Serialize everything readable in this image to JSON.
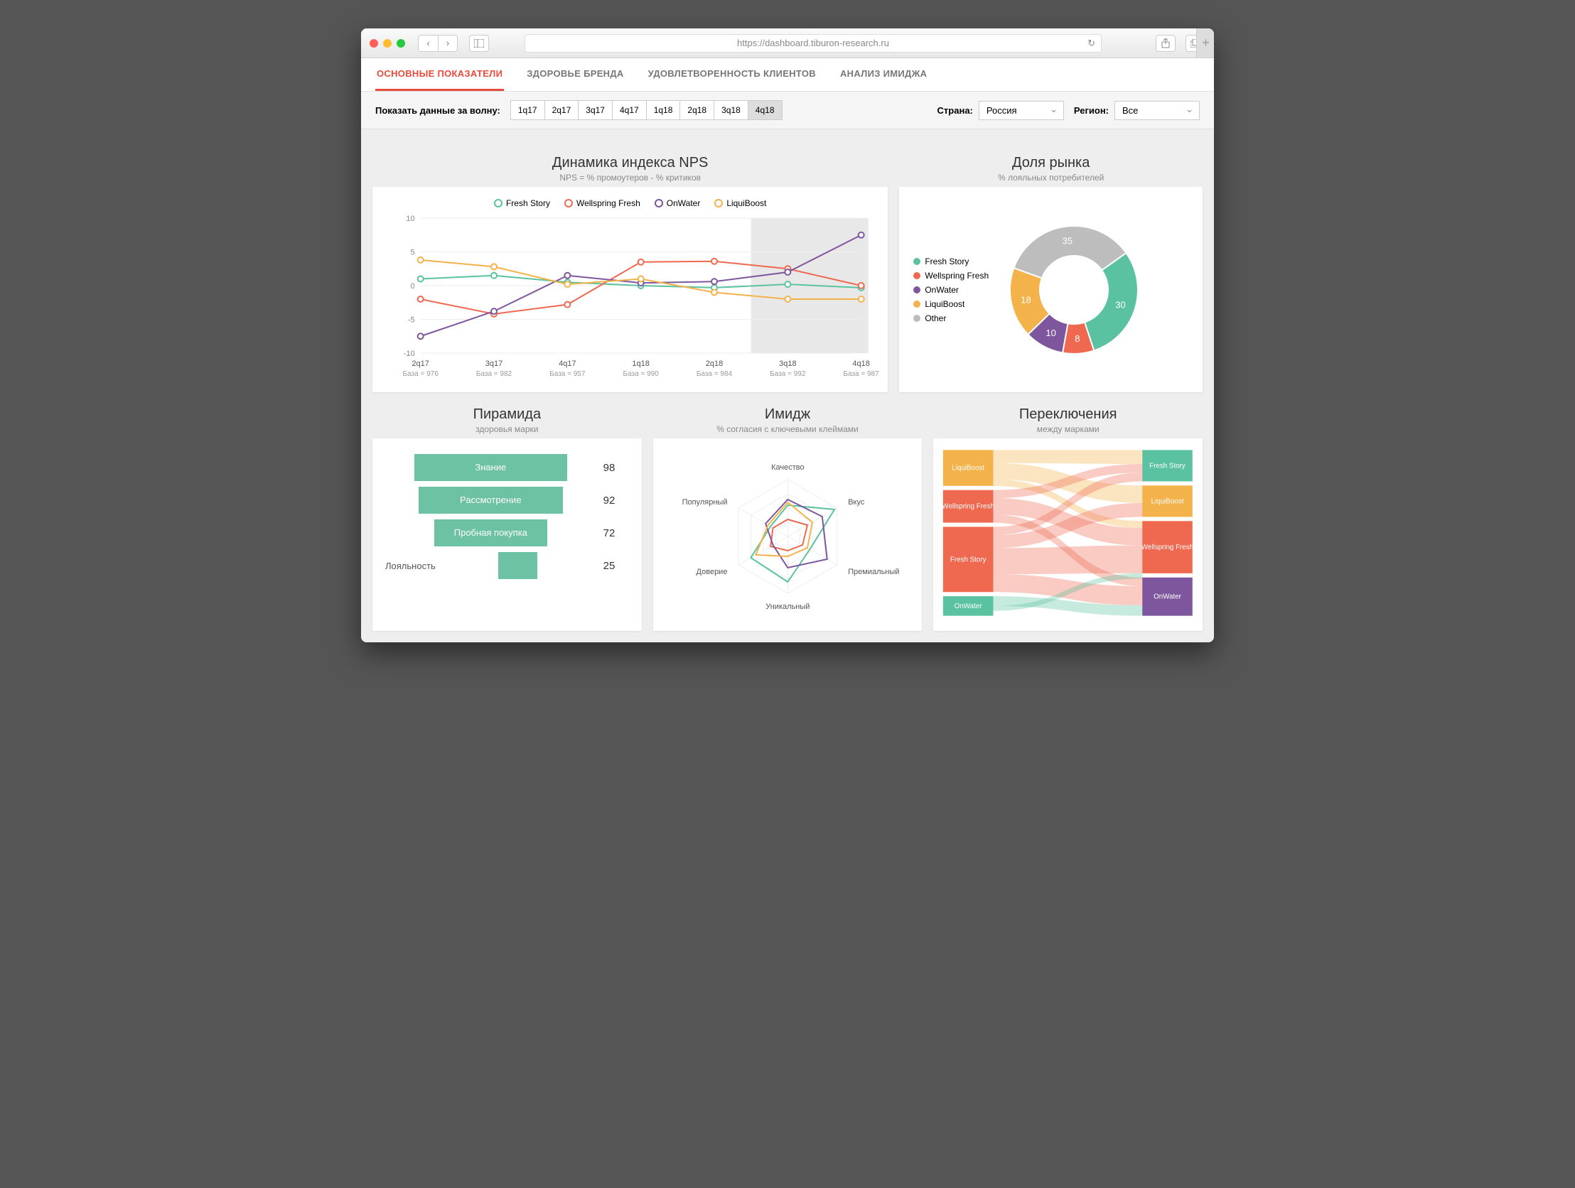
{
  "browser": {
    "url": "https://dashboard.tiburon-research.ru"
  },
  "tabs": [
    "ОСНОВНЫЕ ПОКАЗАТЕЛИ",
    "ЗДОРОВЬЕ БРЕНДА",
    "УДОВЛЕТВОРЕННОСТЬ КЛИЕНТОВ",
    "АНАЛИЗ ИМИДЖА"
  ],
  "active_tab": 0,
  "filters": {
    "wave_label": "Показать данные за волну:",
    "waves": [
      "1q17",
      "2q17",
      "3q17",
      "4q17",
      "1q18",
      "2q18",
      "3q18",
      "4q18"
    ],
    "selected_wave": "4q18",
    "country_label": "Страна:",
    "country_value": "Россия",
    "region_label": "Регион:",
    "region_value": "Все"
  },
  "colors": {
    "fresh_story": "#5bc2a1",
    "wellspring": "#ef6950",
    "onwater": "#7d569d",
    "liquiboost": "#f3b24a",
    "other": "#bdbdbd"
  },
  "nps": {
    "title": "Динамика индекса NPS",
    "subtitle": "NPS = % промоутеров - % критиков",
    "legend": [
      "Fresh Story",
      "Wellspring Fresh",
      "OnWater",
      "LiquiBoost"
    ]
  },
  "market": {
    "title": "Доля рынка",
    "subtitle": "% лояльных потребителей",
    "legend": [
      "Fresh Story",
      "Wellspring Fresh",
      "OnWater",
      "LiquiBoost",
      "Other"
    ]
  },
  "pyramid": {
    "title": "Пирамида",
    "subtitle": "здоровья марки",
    "rows": [
      {
        "label": "Знание",
        "value": 98
      },
      {
        "label": "Рассмотрение",
        "value": 92
      },
      {
        "label": "Пробная покупка",
        "value": 72
      },
      {
        "label": "Лояльность",
        "value": 25
      }
    ]
  },
  "image": {
    "title": "Имидж",
    "subtitle": "% согласия с ключевыми клеймами",
    "axes": [
      "Качество",
      "Вкус",
      "Премиальный",
      "Уникальный",
      "Доверие",
      "Популярный"
    ]
  },
  "switch": {
    "title": "Переключения",
    "subtitle": "между марками",
    "left": [
      "LiquiBoost",
      "Wellspring Fresh",
      "Fresh Story",
      "OnWater"
    ],
    "right": [
      "Fresh Story",
      "LiquiBoost",
      "Wellspring Fresh",
      "OnWater"
    ]
  },
  "chart_data": [
    {
      "id": "nps",
      "type": "line",
      "title": "Динамика индекса NPS",
      "xlabel": "",
      "ylabel": "",
      "ylim": [
        -10,
        10
      ],
      "categories": [
        "2q17",
        "3q17",
        "4q17",
        "1q18",
        "2q18",
        "3q18",
        "4q18"
      ],
      "base_labels": [
        "База = 976",
        "База = 982",
        "База = 957",
        "База = 990",
        "База = 984",
        "База = 992",
        "База = 987"
      ],
      "series": [
        {
          "name": "Fresh Story",
          "color": "#5bc2a1",
          "values": [
            1.0,
            1.5,
            0.5,
            0.0,
            -0.3,
            0.2,
            -0.3
          ]
        },
        {
          "name": "Wellspring Fresh",
          "color": "#ef6950",
          "values": [
            -2.0,
            -4.2,
            -2.8,
            3.5,
            3.6,
            2.5,
            0.0
          ]
        },
        {
          "name": "OnWater",
          "color": "#7d569d",
          "values": [
            -7.5,
            -3.8,
            1.5,
            0.4,
            0.6,
            2.0,
            7.5
          ]
        },
        {
          "name": "LiquiBoost",
          "color": "#f3b24a",
          "values": [
            3.8,
            2.8,
            0.2,
            1.0,
            -1.0,
            -2.0,
            -2.0
          ]
        }
      ],
      "highlight_x": [
        "3q18",
        "4q18"
      ]
    },
    {
      "id": "market_share",
      "type": "pie",
      "title": "Доля рынка",
      "slices": [
        {
          "name": "Fresh Story",
          "value": 30,
          "color": "#5bc2a1"
        },
        {
          "name": "Wellspring Fresh",
          "value": 8,
          "color": "#ef6950"
        },
        {
          "name": "OnWater",
          "value": 10,
          "color": "#7d569d"
        },
        {
          "name": "LiquiBoost",
          "value": 18,
          "color": "#f3b24a"
        },
        {
          "name": "Other",
          "value": 35,
          "color": "#bdbdbd"
        }
      ]
    },
    {
      "id": "pyramid",
      "type": "bar",
      "title": "Пирамида здоровья марки",
      "categories": [
        "Знание",
        "Рассмотрение",
        "Пробная покупка",
        "Лояльность"
      ],
      "values": [
        98,
        92,
        72,
        25
      ]
    },
    {
      "id": "image_radar",
      "type": "radar",
      "title": "Имидж",
      "axes": [
        "Качество",
        "Вкус",
        "Премиальный",
        "Уникальный",
        "Доверие",
        "Популярный"
      ],
      "range": [
        0,
        100
      ],
      "series": [
        {
          "name": "Fresh Story",
          "color": "#5bc2a1",
          "values": [
            55,
            95,
            45,
            80,
            75,
            35
          ]
        },
        {
          "name": "Wellspring Fresh",
          "color": "#ef6950",
          "values": [
            30,
            40,
            30,
            25,
            35,
            30
          ]
        },
        {
          "name": "OnWater",
          "color": "#7d569d",
          "values": [
            65,
            70,
            80,
            55,
            30,
            45
          ]
        },
        {
          "name": "LiquiBoost",
          "color": "#f3b24a",
          "values": [
            60,
            50,
            40,
            35,
            65,
            40
          ]
        }
      ]
    },
    {
      "id": "switching",
      "type": "sankey",
      "title": "Переключения между марками",
      "left_nodes": [
        {
          "name": "LiquiBoost",
          "value": 22,
          "color": "#f3b24a"
        },
        {
          "name": "Wellspring Fresh",
          "value": 20,
          "color": "#ef6950"
        },
        {
          "name": "Fresh Story",
          "value": 40,
          "color": "#ef6950"
        },
        {
          "name": "OnWater",
          "value": 12,
          "color": "#5bc2a1"
        }
      ],
      "right_nodes": [
        {
          "name": "Fresh Story",
          "value": 18,
          "color": "#5bc2a1"
        },
        {
          "name": "LiquiBoost",
          "value": 18,
          "color": "#f3b24a"
        },
        {
          "name": "Wellspring Fresh",
          "value": 30,
          "color": "#ef6950"
        },
        {
          "name": "OnWater",
          "value": 22,
          "color": "#7d569d"
        }
      ],
      "flows": [
        {
          "from": "LiquiBoost",
          "to": "Fresh Story",
          "value": 8
        },
        {
          "from": "LiquiBoost",
          "to": "LiquiBoost",
          "value": 10
        },
        {
          "from": "LiquiBoost",
          "to": "Wellspring Fresh",
          "value": 4
        },
        {
          "from": "Wellspring Fresh",
          "to": "Fresh Story",
          "value": 5
        },
        {
          "from": "Wellspring Fresh",
          "to": "Wellspring Fresh",
          "value": 10
        },
        {
          "from": "Wellspring Fresh",
          "to": "OnWater",
          "value": 5
        },
        {
          "from": "Fresh Story",
          "to": "Fresh Story",
          "value": 5
        },
        {
          "from": "Fresh Story",
          "to": "LiquiBoost",
          "value": 8
        },
        {
          "from": "Fresh Story",
          "to": "Wellspring Fresh",
          "value": 16
        },
        {
          "from": "Fresh Story",
          "to": "OnWater",
          "value": 11
        },
        {
          "from": "OnWater",
          "to": "OnWater",
          "value": 6
        },
        {
          "from": "OnWater",
          "to": "Wellspring Fresh",
          "value": 3
        }
      ]
    }
  ]
}
